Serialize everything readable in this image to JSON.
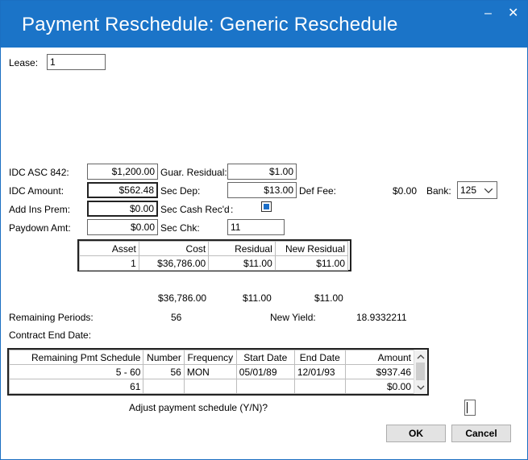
{
  "window": {
    "title": "Payment Reschedule: Generic Reschedule",
    "minimize_glyph": "–",
    "close_glyph": "✕"
  },
  "lease": {
    "label": "Lease:",
    "value": "1"
  },
  "fields": {
    "idc_asc_label": "IDC ASC 842:",
    "idc_asc_value": "$1,200.00",
    "idc_amount_label": "IDC Amount:",
    "idc_amount_value": "$562.48",
    "add_ins_label": "Add Ins Prem:",
    "add_ins_value": "$0.00",
    "paydown_label": "Paydown Amt:",
    "paydown_value": "$0.00",
    "guar_residual_label": "Guar. Residual:",
    "guar_residual_value": "$1.00",
    "sec_dep_label": "Sec Dep:",
    "sec_dep_value": "$13.00",
    "sec_cash_label": "Sec Cash Rec'd",
    "sec_cash_colon": ":",
    "sec_chk_label": "Sec Chk:",
    "sec_chk_value": "11",
    "def_fee_label": "Def Fee:",
    "def_fee_value": "$0.00",
    "bank_label": "Bank:",
    "bank_value": "125"
  },
  "asset_table": {
    "headers": [
      "Asset",
      "Cost",
      "Residual",
      "New Residual"
    ],
    "rows": [
      [
        "1",
        "$36,786.00",
        "$11.00",
        "$11.00"
      ]
    ],
    "totals": [
      "$36,786.00",
      "$11.00",
      "$11.00"
    ]
  },
  "summary": {
    "remaining_periods_label": "Remaining Periods:",
    "remaining_periods_value": "56",
    "new_yield_label": "New Yield:",
    "new_yield_value": "18.9332211",
    "contract_end_label": "Contract End Date:"
  },
  "schedule_table": {
    "headers": [
      "Remaining Pmt Schedule",
      "Number",
      "Frequency",
      "Start Date",
      "End Date",
      "Amount"
    ],
    "rows": [
      [
        "5 - 60",
        "56",
        "MON",
        "05/01/89",
        "12/01/93",
        "$937.46"
      ],
      [
        "61",
        "",
        "",
        "",
        "",
        "$0.00"
      ]
    ]
  },
  "adjust": {
    "label": "Adjust payment schedule (Y/N)?",
    "value": ""
  },
  "buttons": {
    "ok": "OK",
    "cancel": "Cancel"
  }
}
